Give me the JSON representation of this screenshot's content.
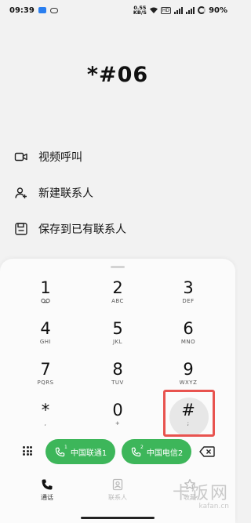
{
  "status_bar": {
    "time": "09:39",
    "net_speed_value": "0.55",
    "net_speed_unit": "KB/S",
    "badge": "HD",
    "battery": "90%"
  },
  "dialed_number": "*#06",
  "actions": [
    {
      "label": "视频呼叫",
      "icon": "video-call-icon"
    },
    {
      "label": "新建联系人",
      "icon": "add-contact-icon"
    },
    {
      "label": "保存到已有联系人",
      "icon": "save-icon"
    }
  ],
  "keys": [
    {
      "digit": "1",
      "sub": "voicemail-icon"
    },
    {
      "digit": "2",
      "sub": "ABC"
    },
    {
      "digit": "3",
      "sub": "DEF"
    },
    {
      "digit": "4",
      "sub": "GHI"
    },
    {
      "digit": "5",
      "sub": "JKL"
    },
    {
      "digit": "6",
      "sub": "MNO"
    },
    {
      "digit": "7",
      "sub": "PQRS"
    },
    {
      "digit": "8",
      "sub": "TUV"
    },
    {
      "digit": "9",
      "sub": "WXYZ"
    },
    {
      "digit": "*",
      "sub": ","
    },
    {
      "digit": "0",
      "sub": "+"
    },
    {
      "digit": "#",
      "sub": ";"
    }
  ],
  "call_buttons": [
    {
      "sim": "1",
      "label": "中国联通1"
    },
    {
      "sim": "2",
      "label": "中国电信2"
    }
  ],
  "bottom_nav": {
    "calls": "通话",
    "contacts": "联系人",
    "favorites": "收藏"
  },
  "watermark": {
    "main": "卡饭网",
    "sub": "kafan.cn"
  },
  "colors": {
    "call_green": "#3db65a",
    "highlight_red": "#e8534f"
  }
}
